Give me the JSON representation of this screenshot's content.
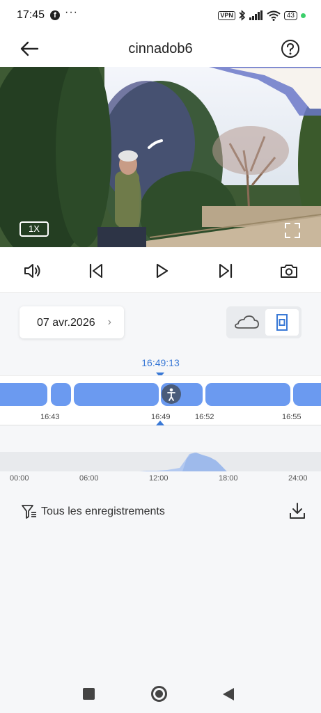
{
  "status_bar": {
    "time": "17:45",
    "more": "···",
    "vpn": "VPN",
    "battery": "43"
  },
  "header": {
    "title": "cinnadob6"
  },
  "video": {
    "zoom_label": "1X"
  },
  "date_picker": {
    "date": "07 avr.2026"
  },
  "timeline": {
    "current_time": "16:49:13",
    "tick_labels": [
      "16:43",
      "16:49",
      "16:52",
      "16:55"
    ]
  },
  "day_overview": {
    "hour_labels": [
      "00:00",
      "06:00",
      "12:00",
      "18:00",
      "24:00"
    ]
  },
  "filter": {
    "label": "Tous les enregistrements"
  },
  "colors": {
    "accent": "#3a79d6",
    "segment": "#6b9af0"
  }
}
